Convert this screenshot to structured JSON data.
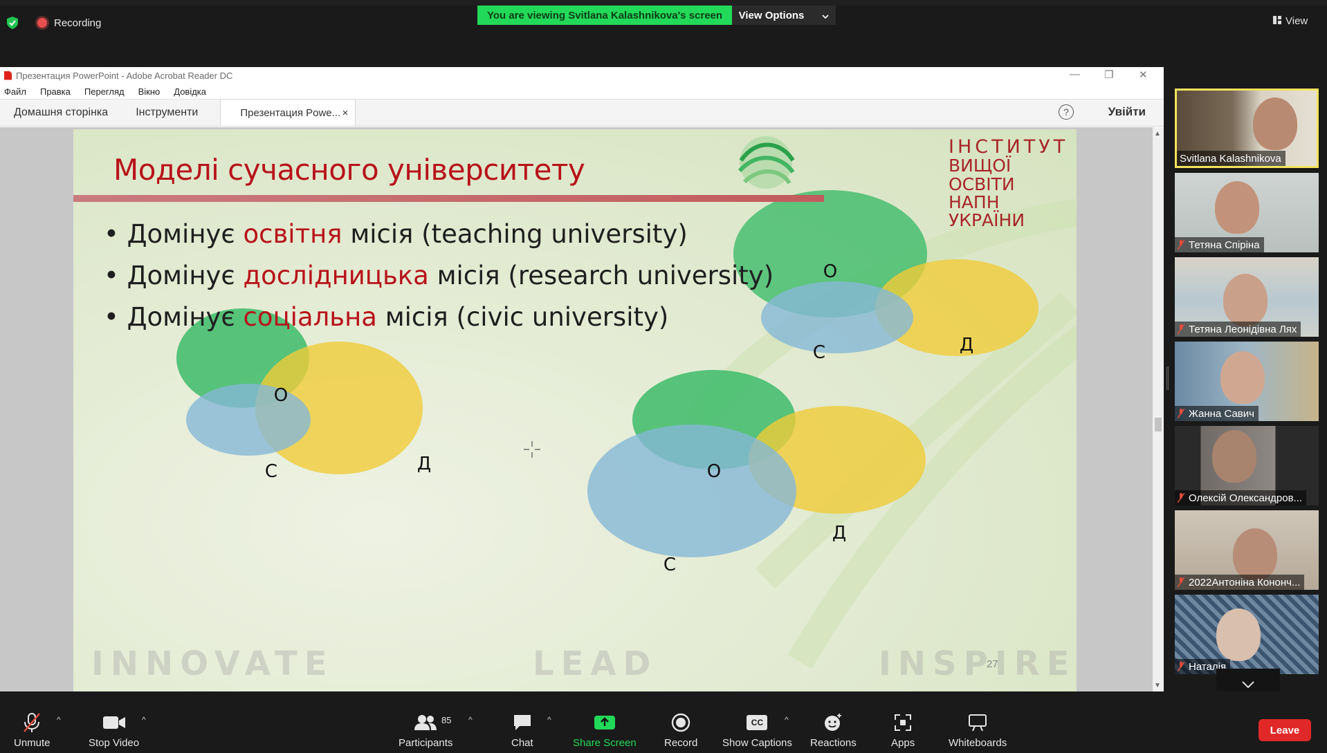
{
  "zoom_top": {
    "recording_label": "Recording",
    "viewing_banner": "You are viewing Svitlana Kalashnikova's screen",
    "view_options_label": "View Options",
    "view_label": "View",
    "colors": {
      "banner": "#23d959",
      "recording_dot": "#e94e4e"
    }
  },
  "acrobat": {
    "window_title": "Презентация PowerPoint - Adobe Acrobat Reader DC",
    "menu": [
      "Файл",
      "Правка",
      "Перегляд",
      "Вікно",
      "Довідка"
    ],
    "tabs": {
      "home": "Домашня сторінка",
      "tools": "Інструменти",
      "doc": "Презентация Powe...",
      "doc_close": "×"
    },
    "help_glyph": "?",
    "login": "Увійти"
  },
  "slide": {
    "title": "Моделі сучасного університету",
    "bullets": [
      {
        "pre": "Домінує ",
        "hl": "освітня",
        "post": " місія (teaching university)"
      },
      {
        "pre": "Домінує ",
        "hl": "дослідницька",
        "post": " місія (research university)"
      },
      {
        "pre": "Домінує ",
        "hl": "соціальна",
        "post": " місія (civic university)"
      }
    ],
    "bullet_mark": "•",
    "logo": {
      "line1": "ІНСТИТУТ",
      "line2": "ВИЩОЇ ОСВІТИ",
      "line3": "НАПН УКРАЇНИ"
    },
    "footer": [
      "INNOVATE",
      "LEAD",
      "INSPIRE"
    ],
    "page_number": "27",
    "venn_labels": {
      "o": "О",
      "d": "Д",
      "c": "С"
    },
    "colors": {
      "title": "#b8111a",
      "green": "#3dbb6a",
      "yellow": "#f0cc3a",
      "blue": "#86b8d6"
    }
  },
  "participants_gallery": [
    {
      "name": "Svitlana Kalashnikova",
      "muted": false,
      "active": true
    },
    {
      "name": "Тетяна Спіріна",
      "muted": true
    },
    {
      "name": "Тетяна Леонідівна Лях",
      "muted": true
    },
    {
      "name": "Жанна Савич",
      "muted": true
    },
    {
      "name": "Олексій Олександров...",
      "muted": true
    },
    {
      "name": "2022Антоніна Кононч...",
      "muted": true
    },
    {
      "name": "Наталія",
      "muted": true
    }
  ],
  "toolbar": {
    "unmute": "Unmute",
    "stop_video": "Stop Video",
    "participants": "Participants",
    "participants_count": "85",
    "chat": "Chat",
    "share_screen": "Share Screen",
    "record": "Record",
    "captions": "Show Captions",
    "captions_glyph": "CC",
    "reactions": "Reactions",
    "apps": "Apps",
    "whiteboards": "Whiteboards",
    "leave": "Leave",
    "colors": {
      "share": "#23d959",
      "leave": "#e02828"
    }
  }
}
